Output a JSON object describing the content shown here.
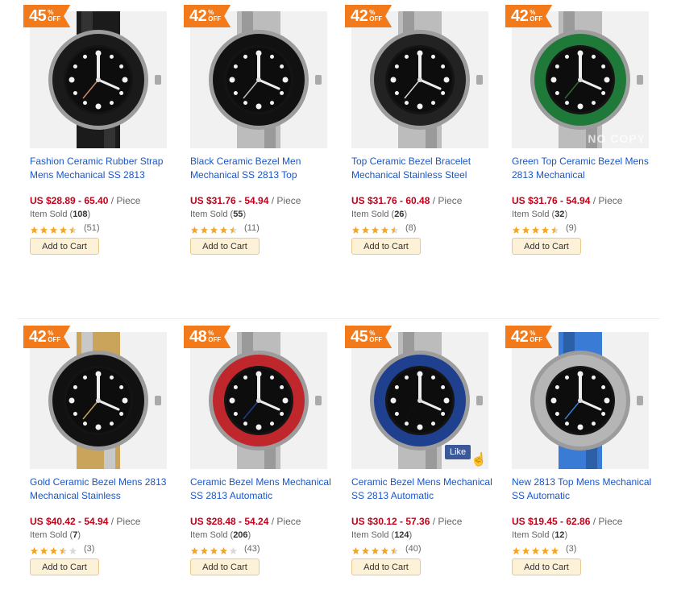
{
  "products": [
    {
      "discount": "45",
      "off_symbol": "%",
      "off_label": "OFF",
      "title": "Fashion Ceramic Rubber Strap Mens Mechanical SS 2813",
      "price_prefix": "US",
      "price": "$28.89 - 65.40",
      "unit": "/ Piece",
      "sold_label": "Item Sold",
      "sold": "108",
      "rating_fraction": 0.9,
      "reviews": "51",
      "cart_label": "Add to Cart",
      "bezel_color": "#1a1a1a",
      "accent_color": "#c98a70",
      "strap": "rubber"
    },
    {
      "discount": "42",
      "off_symbol": "%",
      "off_label": "OFF",
      "title": "Black Ceramic Bezel Men Mechanical SS 2813 Top",
      "price_prefix": "US",
      "price": "$31.76 - 54.94",
      "unit": "/ Piece",
      "sold_label": "Item Sold",
      "sold": "55",
      "rating_fraction": 0.9,
      "reviews": "11",
      "cart_label": "Add to Cart",
      "bezel_color": "#111111",
      "accent_color": "#bfbfbf",
      "strap": "steel"
    },
    {
      "discount": "42",
      "off_symbol": "%",
      "off_label": "OFF",
      "title": "Top Ceramic Bezel Bracelet Mechanical Stainless Steel",
      "price_prefix": "US",
      "price": "$31.76 - 60.48",
      "unit": "/ Piece",
      "sold_label": "Item Sold",
      "sold": "26",
      "rating_fraction": 0.9,
      "reviews": "8",
      "cart_label": "Add to Cart",
      "bezel_color": "#222222",
      "accent_color": "#d8d8d8",
      "strap": "steel"
    },
    {
      "discount": "42",
      "off_symbol": "%",
      "off_label": "OFF",
      "title": "Green Top Ceramic Bezel Mens 2813 Mechanical",
      "price_prefix": "US",
      "price": "$31.76 - 54.94",
      "unit": "/ Piece",
      "sold_label": "Item Sold",
      "sold": "32",
      "rating_fraction": 0.9,
      "reviews": "9",
      "cart_label": "Add to Cart",
      "bezel_color": "#1f7a3a",
      "accent_color": "#2e6b33",
      "strap": "steel",
      "watermark": "NO COPY"
    },
    {
      "discount": "42",
      "off_symbol": "%",
      "off_label": "OFF",
      "title": "Gold Ceramic Bezel Mens 2813 Mechanical Stainless",
      "price_prefix": "US",
      "price": "$40.42 - 54.94",
      "unit": "/ Piece",
      "sold_label": "Item Sold",
      "sold": "7",
      "rating_fraction": 0.7,
      "reviews": "3",
      "cart_label": "Add to Cart",
      "bezel_color": "#111111",
      "accent_color": "#c9a45a",
      "strap": "twotone"
    },
    {
      "discount": "48",
      "off_symbol": "%",
      "off_label": "OFF",
      "title": "Ceramic Bezel Mens Mechanical SS 2813 Automatic",
      "price_prefix": "US",
      "price": "$28.48 - 54.24",
      "unit": "/ Piece",
      "sold_label": "Item Sold",
      "sold": "206",
      "rating_fraction": 0.8,
      "reviews": "43",
      "cart_label": "Add to Cart",
      "bezel_color": "#c0272d",
      "accent_color": "#1f3f8f",
      "strap": "steel"
    },
    {
      "discount": "45",
      "off_symbol": "%",
      "off_label": "OFF",
      "title": "Ceramic Bezel Mens Mechanical SS 2813 Automatic",
      "price_prefix": "US",
      "price": "$30.12 - 57.36",
      "unit": "/ Piece",
      "sold_label": "Item Sold",
      "sold": "124",
      "rating_fraction": 0.9,
      "reviews": "40",
      "cart_label": "Add to Cart",
      "bezel_color": "#1f3f8f",
      "accent_color": "#111111",
      "strap": "steel",
      "like_label": "Like"
    },
    {
      "discount": "42",
      "off_symbol": "%",
      "off_label": "OFF",
      "title": "New 2813 Top Mens Mechanical SS Automatic",
      "price_prefix": "US",
      "price": "$19.45 - 62.86",
      "unit": "/ Piece",
      "sold_label": "Item Sold",
      "sold": "12",
      "rating_fraction": 1.0,
      "reviews": "3",
      "cart_label": "Add to Cart",
      "bezel_color": "#b5b5b5",
      "accent_color": "#3a7bd5",
      "strap": "blue"
    }
  ],
  "colors": {
    "badge": "#f27a1a",
    "title_link": "#1a56c8",
    "price": "#c3001a",
    "star": "#f5a623",
    "star_empty": "#d9d9d9",
    "button_bg": "#fdf1d7"
  }
}
